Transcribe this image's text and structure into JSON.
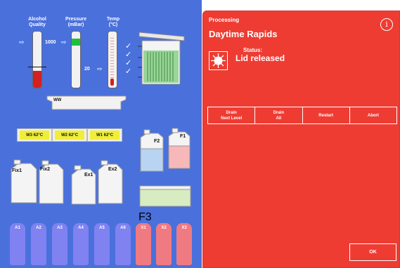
{
  "gauges": {
    "alcohol": {
      "label_line1": "Alcohol",
      "label_line2": "Quality",
      "fill_fraction": 0.3
    },
    "pressure": {
      "label_line1": "Pressure",
      "label_line2": "(mBar)",
      "value_top": "1000",
      "value_bottom": "20"
    },
    "temp": {
      "label_line1": "Temp",
      "label_line2": "(°C)"
    }
  },
  "ww_bath": {
    "label": "WW"
  },
  "wax_baths": [
    {
      "label": "W3  62°C"
    },
    {
      "label": "W2  62°C"
    },
    {
      "label": "W1  62°C"
    }
  ],
  "containers": {
    "f1": "F1",
    "f2": "F2",
    "f3": "F3",
    "fix1": "Fix1",
    "fix2": "Fix2",
    "ex1": "Ex1",
    "ex2": "Ex2"
  },
  "bottles": [
    {
      "label": "A1",
      "color": "#7f82f0"
    },
    {
      "label": "A2",
      "color": "#7f82f0"
    },
    {
      "label": "A3",
      "color": "#7f82f0"
    },
    {
      "label": "A4",
      "color": "#7f82f0"
    },
    {
      "label": "A5",
      "color": "#7f82f0"
    },
    {
      "label": "A6",
      "color": "#7f82f0"
    },
    {
      "label": "X1",
      "color": "#f07a82"
    },
    {
      "label": "X2",
      "color": "#f07a82"
    },
    {
      "label": "X3",
      "color": "#f07a82"
    }
  ],
  "panel": {
    "header": "Processing",
    "title": "Daytime Rapids",
    "info_icon": "i",
    "status_label": "Status:",
    "status_value": "Lid released",
    "buttons": {
      "drain_next_line1": "Drain",
      "drain_next_line2": "Next Level",
      "drain_all_line1": "Drain",
      "drain_all_line2": "All",
      "restart": "Restart",
      "abort": "Abort"
    },
    "ok": "OK"
  },
  "colors": {
    "panel_bg": "#ee3c33",
    "left_bg": "#4a70dc"
  }
}
